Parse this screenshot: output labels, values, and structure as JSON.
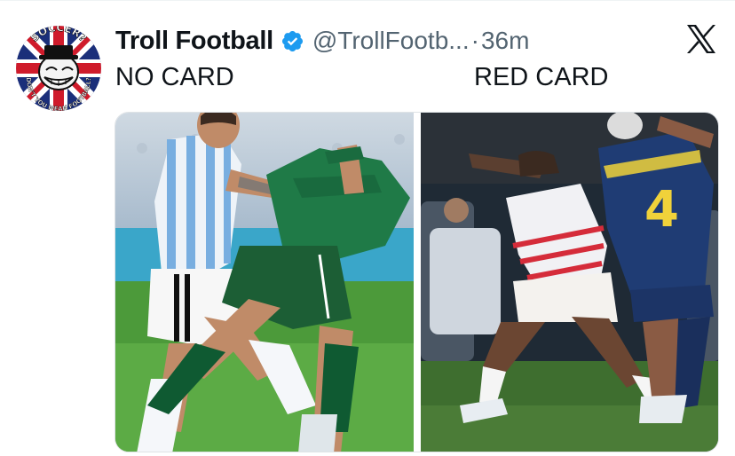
{
  "post": {
    "author": {
      "display_name": "Troll Football",
      "handle": "@TrollFootb...",
      "avatar": {
        "top_text": "SOCCER?",
        "bottom_text": "DON'T YOU MEAN FOOTBALL?"
      },
      "verified": true
    },
    "separator": "·",
    "time_ago": "36m",
    "platform_icon": "x-logo-icon",
    "captions": {
      "left": "NO CARD",
      "right": "RED CARD"
    },
    "media": [
      {
        "description": "photo-left",
        "jersey_number": ""
      },
      {
        "description": "photo-right",
        "jersey_number": "4"
      }
    ]
  },
  "colors": {
    "verified_blue": "#1d9bf0",
    "text_primary": "#0f1419",
    "text_secondary": "#536471"
  }
}
